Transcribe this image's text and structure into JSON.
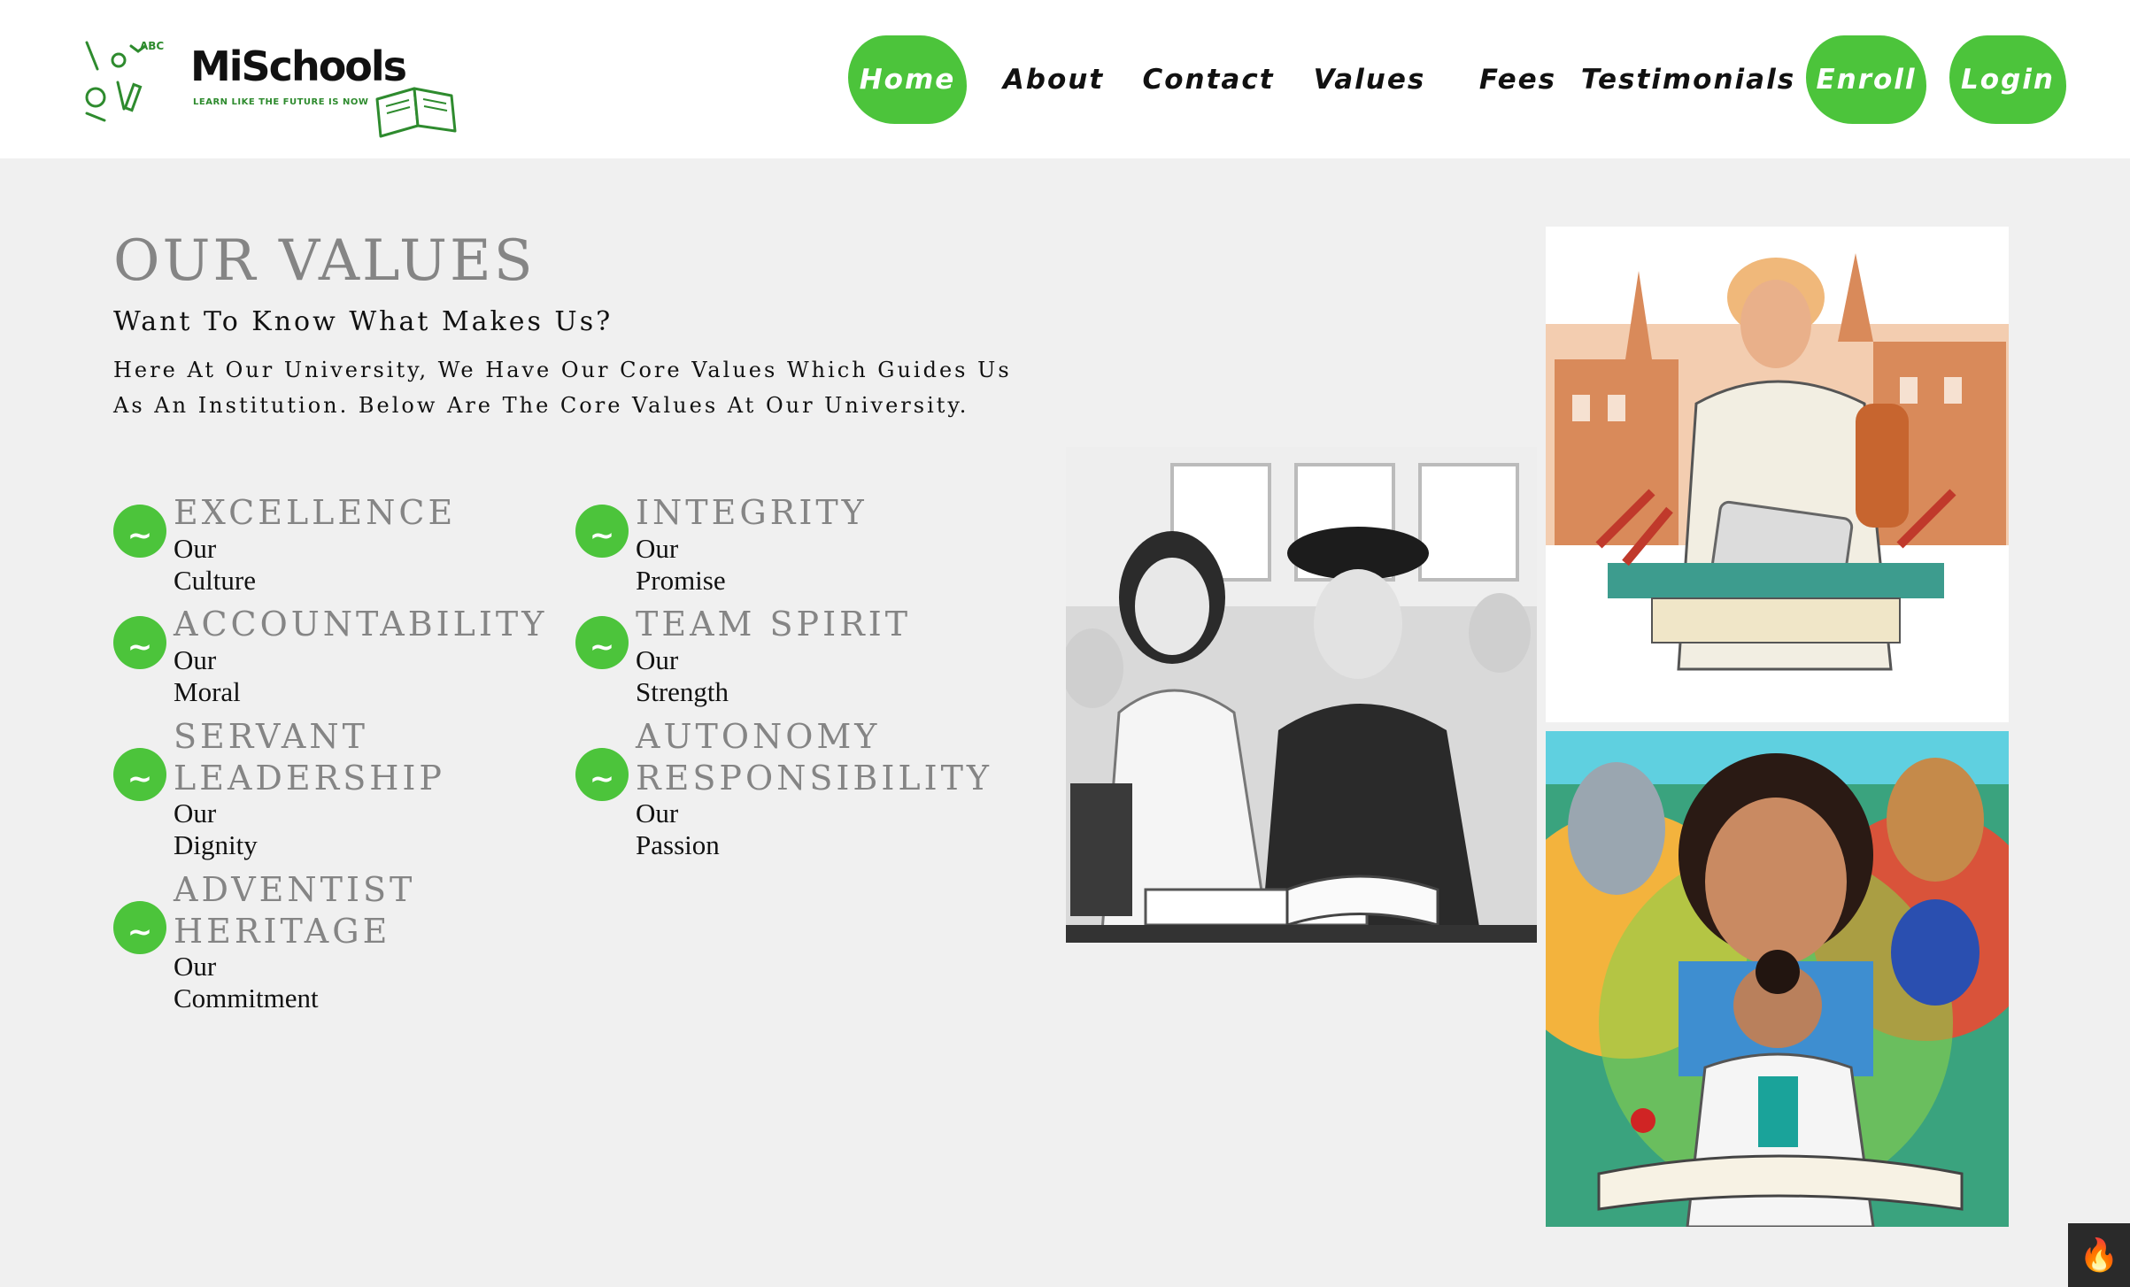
{
  "brand": {
    "name": "MiSchools",
    "tagline": "LEARN LIKE THE FUTURE IS NOW",
    "accent_color": "#4cc43b"
  },
  "nav": {
    "home": "Home",
    "about": "About",
    "contact": "Contact",
    "values": "Values",
    "fees": "Fees",
    "testimonials": "Testimonials",
    "enroll": "Enroll",
    "login": "Login"
  },
  "section": {
    "title": "OUR VALUES",
    "subtitle": "Want To Know What Makes Us?",
    "intro": "Here At Our University, We Have Our Core Values Which Guides Us As An Institution. Below Are The Core Values At Our University."
  },
  "values": [
    {
      "name": "EXCELLENCE",
      "sub": "Our Culture",
      "icon": "~"
    },
    {
      "name": "INTEGRITY",
      "sub": "Our Promise",
      "icon": "~"
    },
    {
      "name": "ACCOUNTABILITY",
      "sub": "Our Moral",
      "icon": "~"
    },
    {
      "name": "TEAM SPIRIT",
      "sub": "Our Strength",
      "icon": "~"
    },
    {
      "name": "SERVANT\nLEADERSHIP",
      "sub": "Our Dignity",
      "icon": "~"
    },
    {
      "name": "AUTONOMY\nRESPONSIBILITY",
      "sub": "Our Passion",
      "icon": "~"
    },
    {
      "name": "ADVENTIST\nHERITAGE",
      "sub": "Our Commitment",
      "icon": "~"
    }
  ],
  "images": {
    "left": "students-bw-illustration",
    "top_right": "student-with-laptop-illustration",
    "bottom_right": "student-mural-illustration"
  },
  "widget": {
    "icon": "flame-icon",
    "glyph": "🔥"
  }
}
